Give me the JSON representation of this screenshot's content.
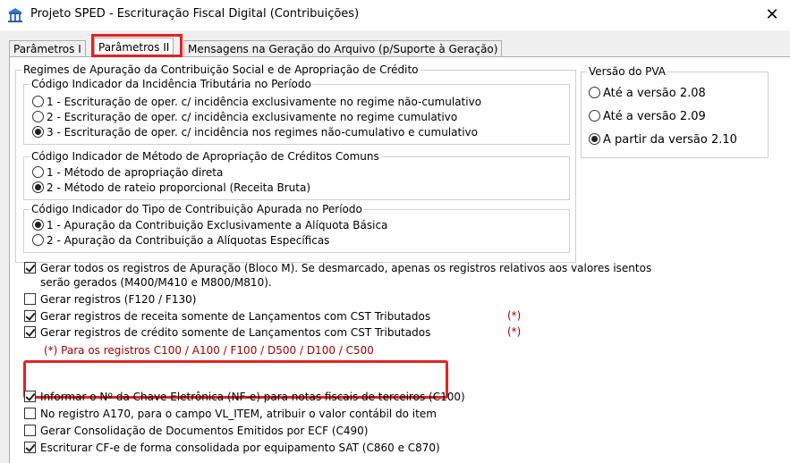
{
  "window": {
    "title": "Projeto SPED - Escrituração Fiscal Digital (Contribuições)",
    "close_glyph": "✕"
  },
  "tabs": [
    {
      "label": "Parâmetros I"
    },
    {
      "label": "Parâmetros II"
    },
    {
      "label": "Mensagens na Geração do Arquivo (p/Suporte à Geração)"
    }
  ],
  "regimes": {
    "title": "Regimes de Apuração da Contribuição Social e de Apropriação de Crédito",
    "incidencia": {
      "title": "Código Indicador da Incidência Tributária no Período",
      "options": [
        "1 - Escrituração de oper. c/ incidência exclusivamente no regime não-cumulativo",
        "2 - Escrituração de oper. c/ incidência exclusivamente no regime cumulativo",
        "3 - Escrituração de oper. c/ incidência nos regimes não-cumulativo e cumulativo"
      ],
      "selected_index": 2
    },
    "metodo": {
      "title": "Código Indicador de Método de Apropriação de Créditos Comuns",
      "options": [
        "1 - Método de apropriação direta",
        "2 - Método de rateio proporcional (Receita Bruta)"
      ],
      "selected_index": 1
    },
    "tipo": {
      "title": "Código Indicador do Tipo de Contribuição Apurada no Período",
      "options": [
        "1 - Apuração da Contribuição Exclusivamente a Alíquota Básica",
        "2 - Apuração da Contribuição a Alíquotas Específicas"
      ],
      "selected_index": 0
    }
  },
  "versao": {
    "title": "Versão do PVA",
    "options": [
      "Até a versão 2.08",
      "Até a versão 2.09",
      "A partir da versão 2.10"
    ],
    "selected_index": 2
  },
  "checks": {
    "bloco_m_line1": "Gerar todos os registros de Apuração (Bloco M). Se desmarcado, apenas os registros relativos aos valores isentos",
    "bloco_m_line2": "serão gerados (M400/M410 e M800/M810).",
    "f120": "Gerar registros (F120 / F130)",
    "receita": "Gerar registros de receita somente de Lançamentos com CST Tributados",
    "credito": "Gerar registros de crédito somente de Lançamentos com CST Tributados",
    "asterisk": "(*)",
    "footnote": "(*) Para os registros C100 / A100 / F100 / D500 / D100 / C500",
    "nfe": "Informar o Nº da Chave Eletrônica (NF-e) para notas fiscais de terceiros (C100)",
    "a170": "No registro A170, para o campo VL_ITEM, atribuir o valor contábil do item",
    "ecf": "Gerar Consolidação de Documentos Emitidos por ECF (C490)",
    "sat": "Escriturar CF-e de forma consolidada por equipamento SAT (C860 e C870)"
  },
  "checks_state": {
    "bloco_m": true,
    "f120": false,
    "receita": true,
    "credito": true,
    "nfe": true,
    "a170": false,
    "ecf": false,
    "sat": true
  },
  "colors": {
    "highlight": "#e32222",
    "footnote": "#a00000"
  }
}
